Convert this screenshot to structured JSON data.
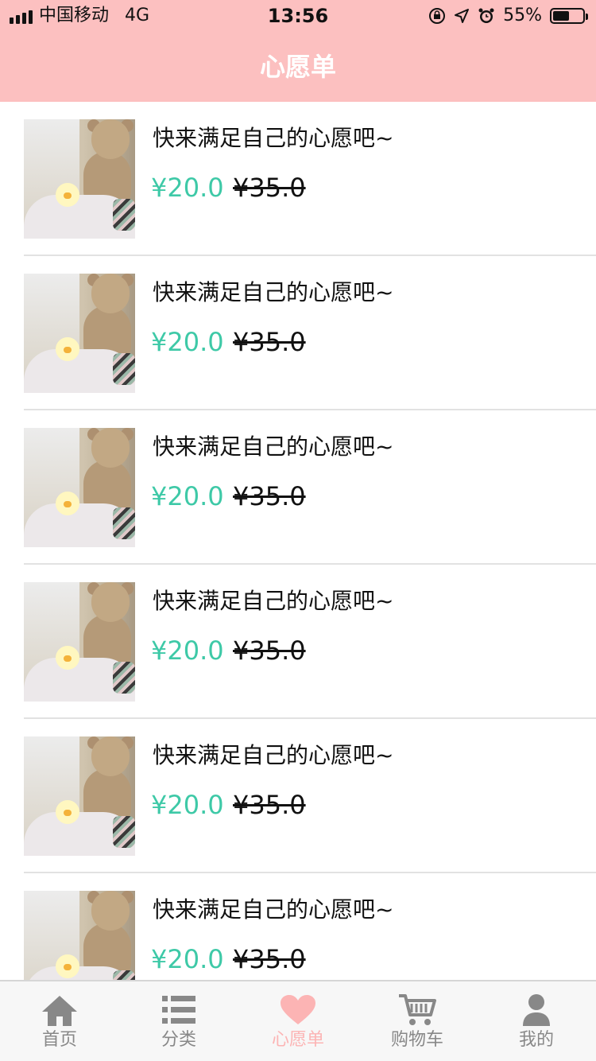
{
  "status_bar": {
    "carrier": "中国移动",
    "network": "4G",
    "time": "13:56",
    "battery": "55%",
    "battery_level": 0.55
  },
  "header": {
    "title": "心愿单"
  },
  "wishlist": {
    "items": [
      {
        "title": "快来满足自己的心愿吧~",
        "price": "¥20.0",
        "original_price": "¥35.0"
      },
      {
        "title": "快来满足自己的心愿吧~",
        "price": "¥20.0",
        "original_price": "¥35.0"
      },
      {
        "title": "快来满足自己的心愿吧~",
        "price": "¥20.0",
        "original_price": "¥35.0"
      },
      {
        "title": "快来满足自己的心愿吧~",
        "price": "¥20.0",
        "original_price": "¥35.0"
      },
      {
        "title": "快来满足自己的心愿吧~",
        "price": "¥20.0",
        "original_price": "¥35.0"
      },
      {
        "title": "快来满足自己的心愿吧~",
        "price": "¥20.0",
        "original_price": "¥35.0"
      }
    ]
  },
  "tabbar": {
    "items": [
      {
        "label": "首页",
        "icon": "home-icon",
        "active": false
      },
      {
        "label": "分类",
        "icon": "list-icon",
        "active": false
      },
      {
        "label": "心愿单",
        "icon": "heart-icon",
        "active": true
      },
      {
        "label": "购物车",
        "icon": "cart-icon",
        "active": false
      },
      {
        "label": "我的",
        "icon": "user-icon",
        "active": false
      }
    ]
  },
  "colors": {
    "header_bg": "#fcc0c0",
    "price": "#3ec9a7",
    "tab_active": "#fcb4b4",
    "tab_inactive": "#888888"
  }
}
